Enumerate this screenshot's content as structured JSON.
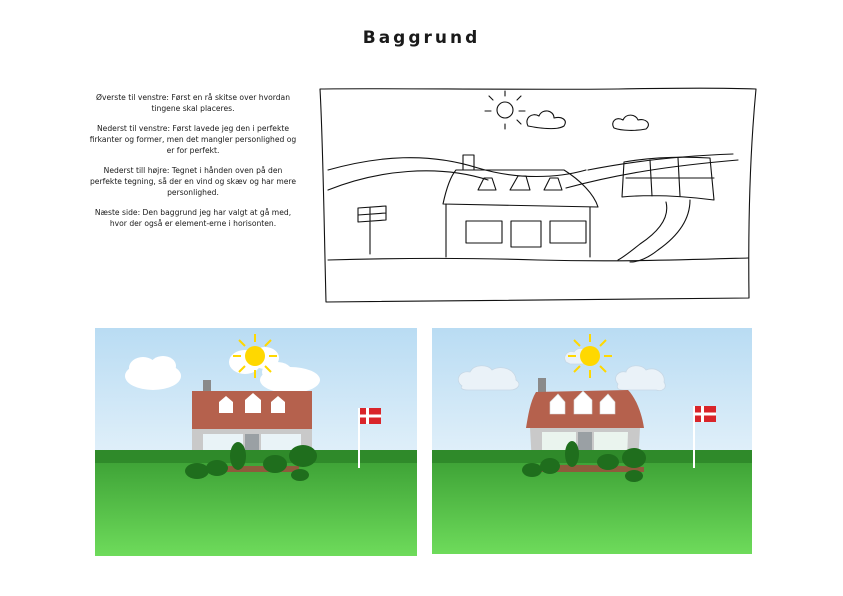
{
  "page": {
    "title": "Baggrund"
  },
  "notes": [
    "Øverste til venstre: Først en rå skitse over hvordan tingene skal placeres.",
    "Nederst til venstre: Først lavede jeg den i perfekte firkanter og former, men det mangler personlighed og er for perfekt.",
    "Nederst till højre: Tegnet i hånden oven på den perfekte tegning, så der en vind og skæv og har mere personlighed.",
    "Næste side: Den baggrund jeg har valgt at gå med, hvor der også er element-erne i horisonten."
  ],
  "colors": {
    "sky_top": "#b9dcf3",
    "grass": "#6edb5b",
    "hedge": "#2f8a2a",
    "roof": "#b5614d",
    "sun": "#ffd800",
    "flag_red": "#d9252a"
  },
  "figures": [
    {
      "name": "sketch",
      "icon": "house-sketch"
    },
    {
      "name": "perfect-version",
      "icon": "house-illustration"
    },
    {
      "name": "hand-drawn-version",
      "icon": "house-illustration"
    }
  ]
}
